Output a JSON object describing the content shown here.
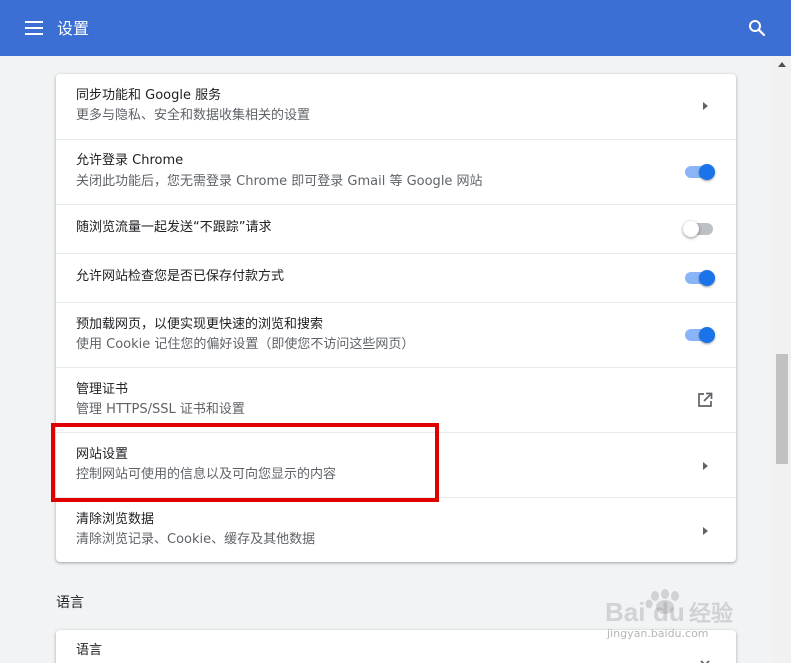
{
  "toolbar": {
    "title": "设置",
    "menu_icon": "menu-icon",
    "search_icon": "search-icon"
  },
  "privacy": {
    "rows": [
      {
        "title": "同步功能和 Google 服务",
        "subtitle": "更多与隐私、安全和数据收集相关的设置",
        "control": "chevron-right-icon"
      },
      {
        "title": "允许登录 Chrome",
        "subtitle": "关闭此功能后，您无需登录 Chrome 即可登录 Gmail 等 Google 网站",
        "control": "toggle",
        "checked": true
      },
      {
        "title": "随浏览流量一起发送“不跟踪”请求",
        "control": "toggle",
        "checked": false
      },
      {
        "title": "允许网站检查您是否已保存付款方式",
        "control": "toggle",
        "checked": true
      },
      {
        "title": "预加载网页，以便实现更快速的浏览和搜索",
        "subtitle": "使用 Cookie 记住您的偏好设置（即使您不访问这些网页）",
        "control": "toggle",
        "checked": true
      },
      {
        "title": "管理证书",
        "subtitle": "管理 HTTPS/SSL 证书和设置",
        "control": "open-in-new-icon"
      },
      {
        "title": "网站设置",
        "subtitle": "控制网站可使用的信息以及可向您显示的内容",
        "control": "chevron-right-icon",
        "highlighted": true
      },
      {
        "title": "清除浏览数据",
        "subtitle": "清除浏览记录、Cookie、缓存及其他数据",
        "control": "chevron-right-icon"
      }
    ]
  },
  "languages": {
    "section_title": "语言",
    "row_title": "语言",
    "control": "expand-more-icon"
  },
  "watermark": {
    "logo_text": "Baidu经验",
    "url": "jingyan.baidu.com"
  },
  "colors": {
    "toolbar": "#3b6fd4",
    "toggle_on": "#1a73e8",
    "highlight_box": "#e00000"
  }
}
